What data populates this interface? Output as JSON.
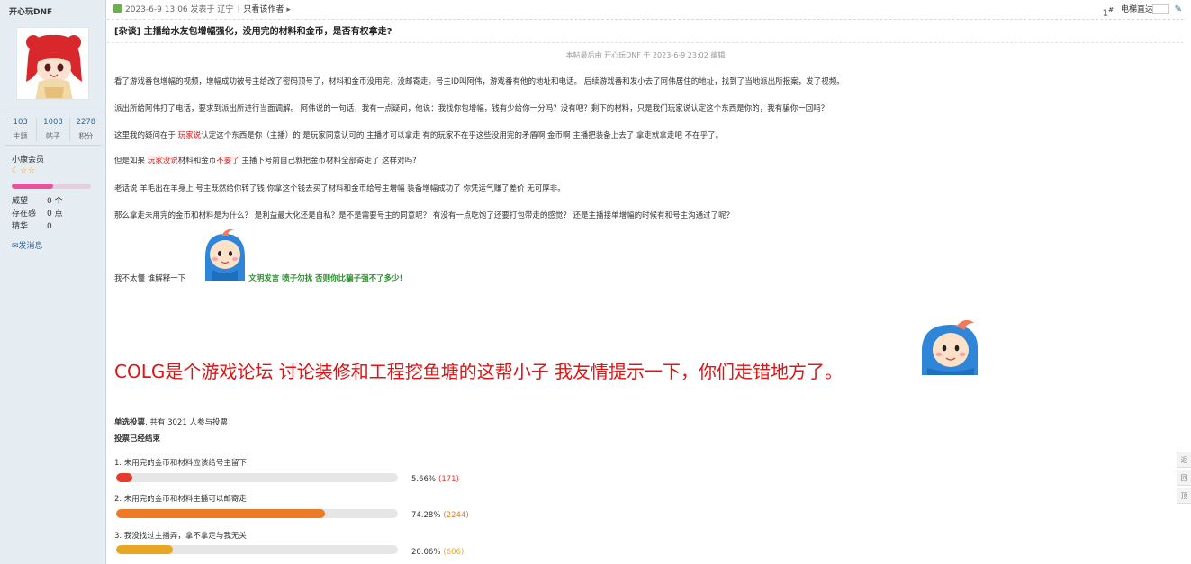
{
  "sidebar": {
    "username": "开心玩DNF",
    "stats": [
      {
        "value": "103",
        "label": "主题"
      },
      {
        "value": "1008",
        "label": "帖子"
      },
      {
        "value": "2278",
        "label": "积分"
      }
    ],
    "group": "小康会员",
    "level_progress": 0.52,
    "info": [
      {
        "key": "威望",
        "value": "0 个"
      },
      {
        "key": "存在感",
        "value": "0 点"
      },
      {
        "key": "精华",
        "value": "0"
      }
    ],
    "message_label": "发消息"
  },
  "post": {
    "meta": "2023-6-9 13:06 发表于 辽宁",
    "author_only": "只看该作者",
    "floor": "1",
    "floor_sup": "#",
    "jump_label": "电梯直达",
    "title": "[杂谈] 主播给水友包增幅强化，没用完的材料和金币，是否有权拿走?",
    "edit_note": "本帖最后由 开心玩DNF 于 2023-6-9 23:02 编辑",
    "p1": "看了游戏番包增幅的视频，增幅成功被号主给改了密码顶号了，材料和金币没用完，没邮寄走。号主ID叫阿伟，游戏番有他的地址和电话。 后续游戏番和发小去了阿伟居住的地址，找到了当地派出所报案，发了视频。",
    "p2": "派出所给阿伟打了电话，要求到派出所进行当面调解。 阿伟说的一句话，我有一点疑问，他说：我找你包增幅，钱有少给你一分吗？没有吧？剩下的材料，只是我们玩家说认定这个东西是你的，我有骗你一回吗？",
    "p3_a": "这里我的疑问在于 ",
    "p3_red": "玩家说",
    "p3_b": "认定这个东西是你（主播）的  是玩家同意认可的  主播才可以拿走  有的玩家不在乎这些没用完的矛盾啊 金币啊  主播把装备上去了  拿走就拿走吧  不在乎了。",
    "p4_a": "但是如果 ",
    "p4_red1": "玩家没说",
    "p4_b": "材料和金币",
    "p4_red2": "不要了",
    "p4_c": "   主播下号前自己就把金币材料全部寄走了  这样对吗?",
    "p5": "老话说  羊毛出在羊身上    号主既然给你转了钱    你拿这个钱去买了材料和金币给号主增幅     装备增幅成功了  你凭运气赚了差价 无可厚非。",
    "p6": "那么拿走未用完的金币和材料是为什么？   是利益最大化还是自私？是不是需要号主的同意呢？ 有没有一点吃饱了还要打包带走的感觉？   还是主播接单增幅的时候有和号主沟通过了呢？",
    "p7": "我不太懂  谁解释一下",
    "p7_green": "文明发言 喷子勿扰  否则你比骗子强不了多少!",
    "big_text": "COLG是个游戏论坛   讨论装修和工程挖鱼塘的这帮小子  我友情提示一下，你们走错地方了。"
  },
  "poll": {
    "header_bold": "单选投票",
    "header_rest": ", 共有 3021 人参与投票",
    "ended": "投票已经结束",
    "options": [
      {
        "label": "1.  未用完的金币和材料应该给号主留下",
        "percent": "5.66%",
        "count": "(171)",
        "fraction": 0.0566,
        "color": "#e53a2c"
      },
      {
        "label": "2.  未用完的金币和材料主播可以邮寄走",
        "percent": "74.28%",
        "count": "(2244)",
        "fraction": 0.7428,
        "color": "#ec7a27"
      },
      {
        "label": "3.  我没找过主播弄，拿不拿走与我无关",
        "percent": "20.06%",
        "count": "(606)",
        "fraction": 0.2006,
        "color": "#e9a625"
      }
    ]
  },
  "tools": [
    "返",
    "回",
    "顶"
  ]
}
